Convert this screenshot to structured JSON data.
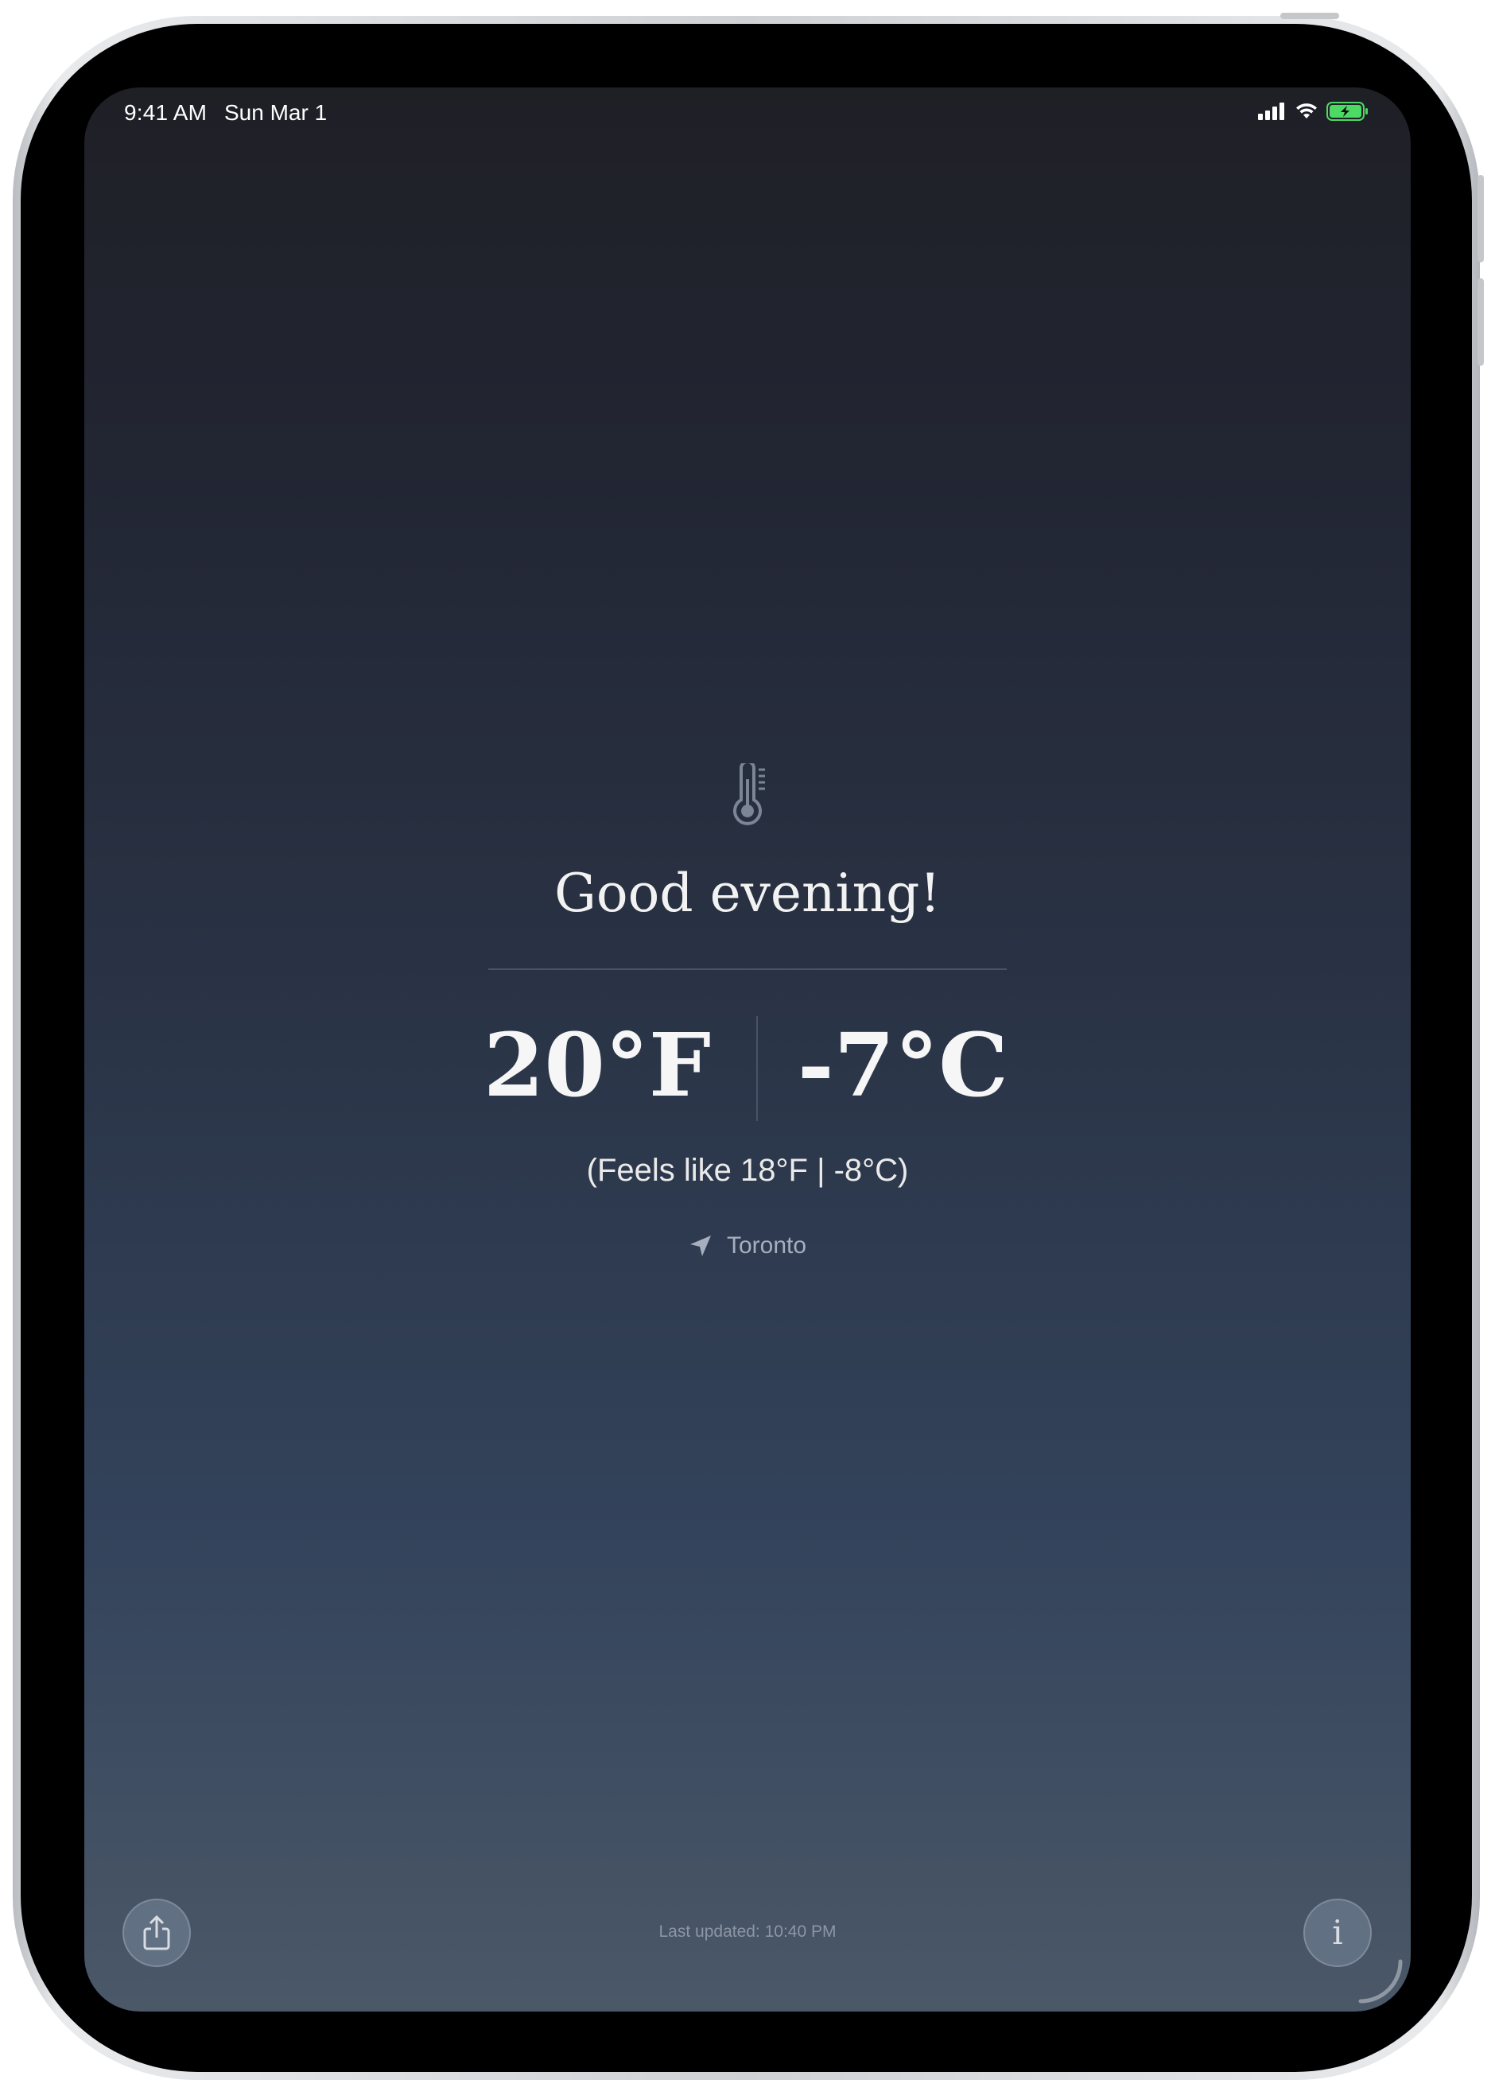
{
  "status_bar": {
    "time": "9:41 AM",
    "date": "Sun Mar 1",
    "icons": [
      "cellular-signal-icon",
      "wifi-icon",
      "battery-charging-icon"
    ],
    "battery_color": "#4cd964"
  },
  "main": {
    "icon": "thermometer-icon",
    "greeting": "Good evening!",
    "temperature_f": "20°F",
    "temperature_c": "-7°C",
    "feels_like": "(Feels like 18°F | -8°C)",
    "location_icon": "location-arrow-icon",
    "location": "Toronto"
  },
  "footer": {
    "share_icon": "share-icon",
    "info_label": "i",
    "last_updated": "Last updated: 10:40 PM"
  },
  "colors": {
    "background_top": "#1f2026",
    "background_bottom": "#4b5868",
    "secondary_text": "#a5afbe"
  }
}
